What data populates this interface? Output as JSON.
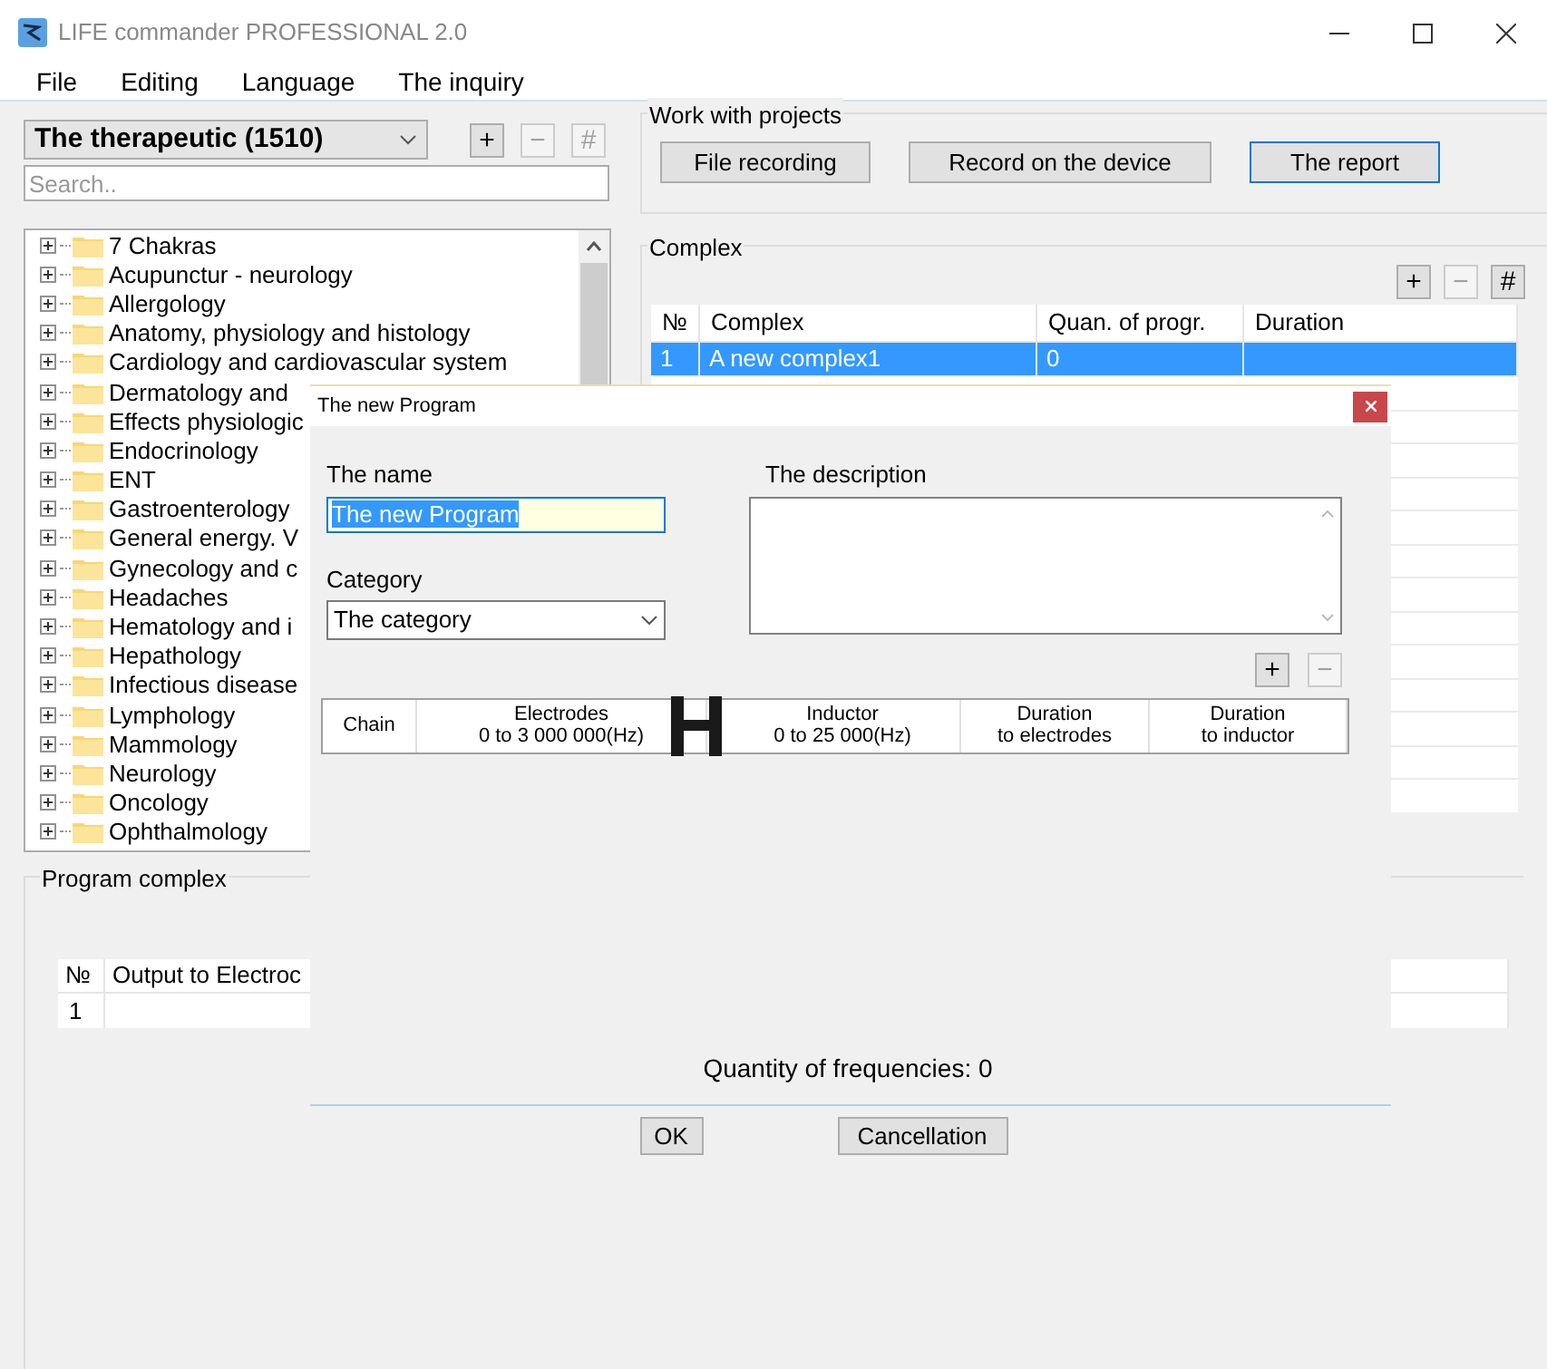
{
  "window": {
    "title": "LIFE commander PROFESSIONAL 2.0"
  },
  "menu": [
    {
      "label": "File"
    },
    {
      "label": "Editing"
    },
    {
      "label": "Language"
    },
    {
      "label": "The inquiry"
    }
  ],
  "base_select": {
    "value": "The therapeutic (1510)"
  },
  "base_buttons": [
    {
      "label": "+",
      "disabled": false
    },
    {
      "label": "−",
      "disabled": true
    },
    {
      "label": "#",
      "disabled": true
    }
  ],
  "search": {
    "placeholder": "Search.."
  },
  "tree": {
    "items": [
      {
        "label": "7 Chakras"
      },
      {
        "label": "Acupunctur - neurology"
      },
      {
        "label": "Allergology"
      },
      {
        "label": "Anatomy, physiology and histology"
      },
      {
        "label": "Cardiology and cardiovascular system"
      },
      {
        "label": "Dermatology and"
      },
      {
        "label": "Effects physiologic"
      },
      {
        "label": "Endocrinology"
      },
      {
        "label": "ENT"
      },
      {
        "label": "Gastroenterology"
      },
      {
        "label": "General energy. V"
      },
      {
        "label": "Gynecology and c"
      },
      {
        "label": "Headaches"
      },
      {
        "label": "Hematology and i"
      },
      {
        "label": "Hepathology"
      },
      {
        "label": "Infectious disease"
      },
      {
        "label": "Lymphology"
      },
      {
        "label": "Mammology"
      },
      {
        "label": "Neurology"
      },
      {
        "label": "Oncology"
      },
      {
        "label": "Ophthalmology"
      }
    ]
  },
  "projects": {
    "title": "Work with projects",
    "buttons": [
      {
        "label": "File recording",
        "focused": false
      },
      {
        "label": "Record on the device",
        "focused": false
      },
      {
        "label": "The report",
        "focused": true
      }
    ]
  },
  "complex": {
    "title": "Complex",
    "buttons": [
      {
        "label": "+",
        "disabled": false
      },
      {
        "label": "−",
        "disabled": true
      },
      {
        "label": "#",
        "disabled": false
      }
    ],
    "columns": [
      "№",
      "Complex",
      "Quan. of progr.",
      "Duration"
    ],
    "rows": [
      {
        "cells": [
          "1",
          "A new complex1",
          "0",
          ""
        ],
        "selected": true
      }
    ]
  },
  "program_complex": {
    "title": "Program complex",
    "columns": [
      "№",
      "Output to Electroc"
    ],
    "rows": [
      {
        "cells": [
          "1",
          ""
        ]
      }
    ]
  },
  "dialog": {
    "title": "The new Program",
    "name_label": "The name",
    "name_value": "The new Program",
    "category_label": "Category",
    "category_value": "The category",
    "description_label": "The description",
    "buttons": [
      {
        "label": "+",
        "disabled": false
      },
      {
        "label": "−",
        "disabled": true
      }
    ],
    "columns": [
      {
        "line1": "Chain"
      },
      {
        "line1": "Electrodes",
        "line2": "0 to 3 000 000(Hz)"
      },
      {
        "line1": "Inductor",
        "line2": "0 to 25 000(Hz)"
      },
      {
        "line1": "Duration",
        "line2": "to electrodes"
      },
      {
        "line1": "Duration",
        "line2": "to inductor"
      }
    ],
    "quantity": "Quantity of frequencies: 0",
    "ok": "OK",
    "cancel": "Cancellation"
  }
}
